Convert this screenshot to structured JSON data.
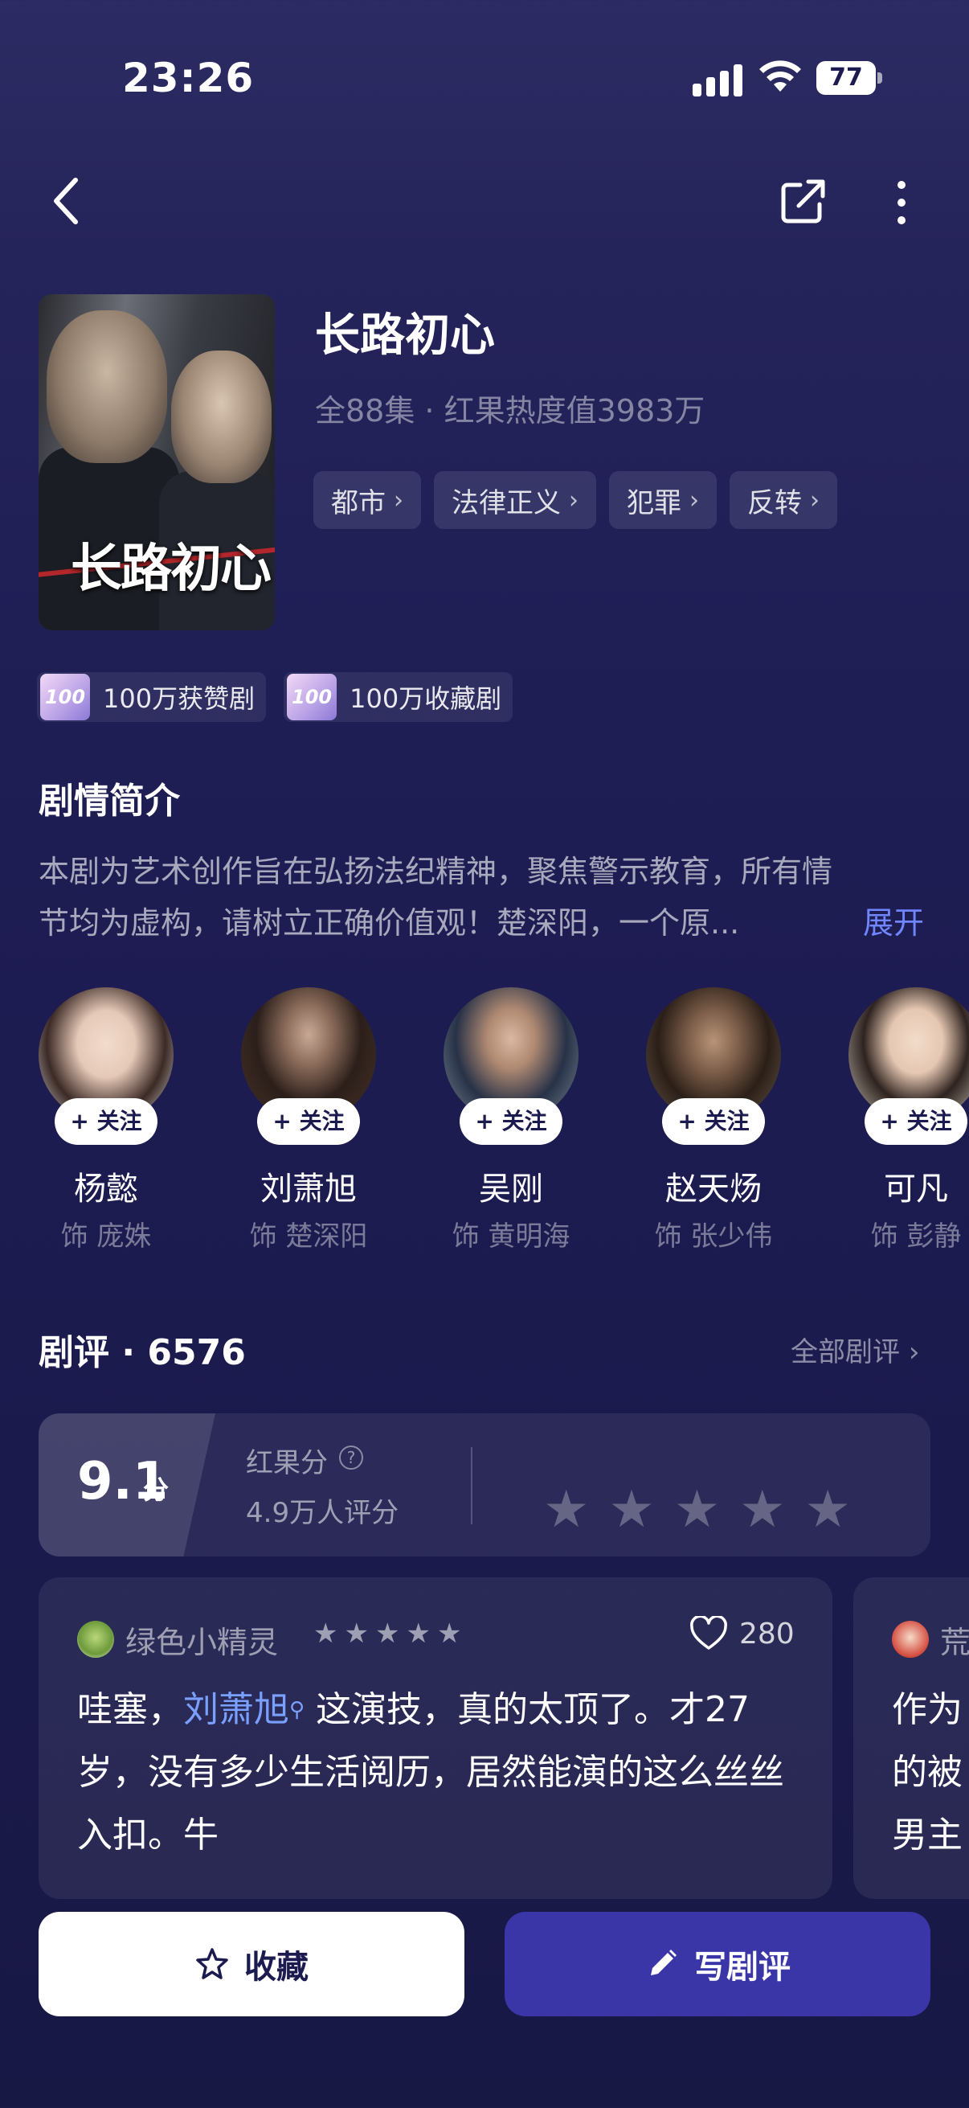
{
  "status": {
    "time": "23:26",
    "battery": "77"
  },
  "show": {
    "title": "长路初心",
    "poster_title": "长路初心",
    "meta": "全88集 · 红果热度值3983万",
    "tags": [
      "都市",
      "法律正义",
      "犯罪",
      "反转"
    ],
    "badges": [
      {
        "icon_text": "100",
        "label": "100万获赞剧"
      },
      {
        "icon_text": "100",
        "label": "100万收藏剧"
      }
    ]
  },
  "synopsis": {
    "title": "剧情简介",
    "line1": "本剧为艺术创作旨在弘扬法纪精神，聚焦警示教育，所有情",
    "line2": "节均为虚构，请树立正确价值观！楚深阳，一个原...",
    "expand": "展开"
  },
  "cast": {
    "follow_label": "+ 关注",
    "actors": [
      {
        "name": "杨懿",
        "role": "饰 庞姝"
      },
      {
        "name": "刘萧旭",
        "role": "饰 楚深阳"
      },
      {
        "name": "吴刚",
        "role": "饰 黄明海"
      },
      {
        "name": "赵天炀",
        "role": "饰 张少伟"
      },
      {
        "name": "可凡",
        "role": "饰 彭静"
      }
    ]
  },
  "reviews": {
    "title": "剧评 · 6576",
    "all_link": "全部剧评",
    "score": "9.1",
    "score_unit": "分",
    "score_label": "红果分",
    "score_count": "4.9万人评分",
    "cards": [
      {
        "user": "绿色小精灵",
        "rating": 5,
        "likes": "280",
        "text_before": "哇塞，",
        "link": "刘萧旭",
        "text_after": " 这演技，真的太顶了。才27岁，没有多少生活阅历，居然能演的这么丝丝入扣。牛"
      },
      {
        "user": "荒",
        "text": "作为\n的被\n男主"
      }
    ]
  },
  "actions": {
    "favorite": "收藏",
    "write_review": "写剧评"
  },
  "colors": {
    "accent": "#3a36a8",
    "link": "#7aa0ff",
    "background": "#1f1e55"
  }
}
